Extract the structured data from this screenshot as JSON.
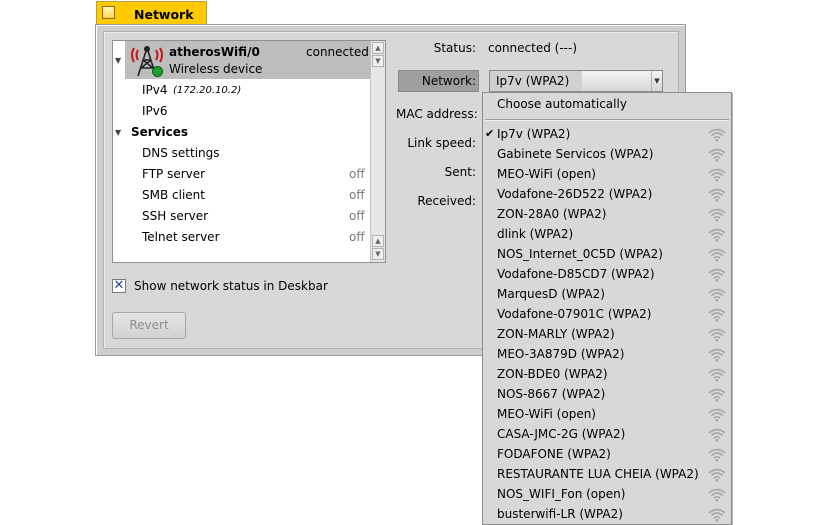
{
  "window": {
    "title": "Network"
  },
  "device": {
    "name": "atherosWifi/0",
    "status": "connected",
    "type": "Wireless device"
  },
  "list": {
    "ipv4_label": "IPv4",
    "ipv4_addr": "(172.20.10.2)",
    "ipv6_label": "IPv6",
    "services_header": "Services",
    "services": [
      {
        "name": "DNS settings",
        "state": ""
      },
      {
        "name": "FTP server",
        "state": "off"
      },
      {
        "name": "SMB client",
        "state": "off"
      },
      {
        "name": "SSH server",
        "state": "off"
      },
      {
        "name": "Telnet server",
        "state": "off"
      }
    ]
  },
  "details": {
    "status_label": "Status:",
    "status_value": "connected (---)",
    "network_label": "Network:",
    "network_value": "Ip7v (WPA2)",
    "mac_label": "MAC address:",
    "link_label": "Link speed:",
    "sent_label": "Sent:",
    "received_label": "Received:"
  },
  "checkbox": {
    "label": "Show network status in Deskbar",
    "checked": true
  },
  "buttons": {
    "revert": "Revert"
  },
  "menu": {
    "auto": "Choose automatically",
    "selected_index": 0,
    "networks": [
      "Ip7v (WPA2)",
      "Gabinete Servicos (WPA2)",
      "MEO-WiFi (open)",
      "Vodafone-26D522 (WPA2)",
      "ZON-28A0 (WPA2)",
      "dlink (WPA2)",
      "NOS_Internet_0C5D (WPA2)",
      "Vodafone-D85CD7 (WPA2)",
      "MarquesD (WPA2)",
      "Vodafone-07901C (WPA2)",
      "ZON-MARLY (WPA2)",
      "MEO-3A879D (WPA2)",
      "ZON-BDE0 (WPA2)",
      "NOS-8667 (WPA2)",
      "MEO-WiFi (open)",
      "CASA-JMC-2G (WPA2)",
      "FODAFONE (WPA2)",
      "RESTAURANTE LUA CHEIA (WPA2)",
      "NOS_WIFI_Fon (open)",
      "busterwifi-LR (WPA2)"
    ]
  },
  "colors": {
    "tab": "#ffcb00",
    "check": "#1a47b5",
    "signal": "#9a9a9a",
    "antenna_rays": "#c01818",
    "status_dot": "#1aa12a"
  }
}
